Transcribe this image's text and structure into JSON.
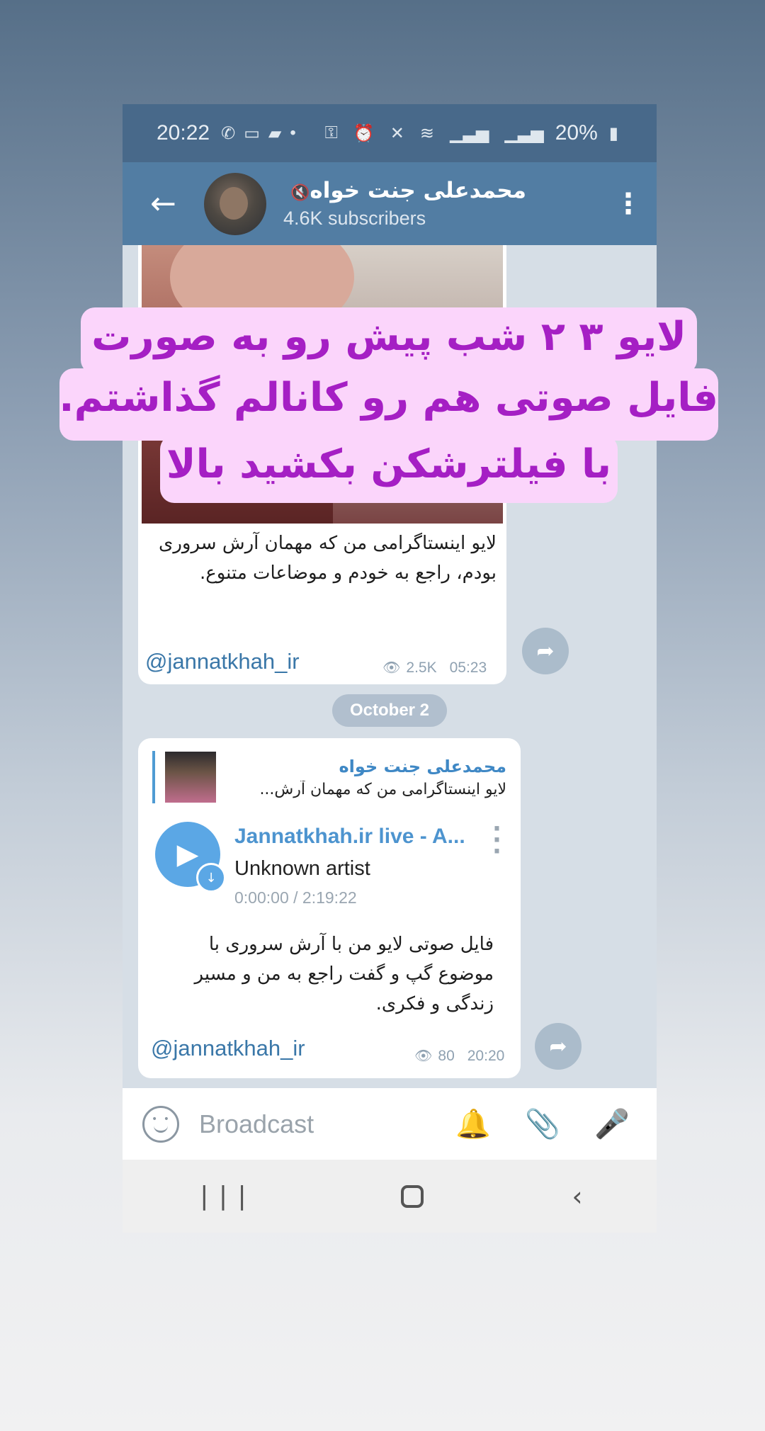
{
  "status_bar": {
    "time": "20:22",
    "left_icons": [
      "whatsapp-icon",
      "laptop-icon",
      "chat-icon",
      "dot-icon"
    ],
    "right_icons": [
      "key-icon",
      "alarm-icon",
      "mute-icon",
      "wifi-icon",
      "signal-icon",
      "signal-icon"
    ],
    "battery": "20%"
  },
  "header": {
    "channel_name": "محمدعلی جنت خواه",
    "muted": true,
    "subscribers": "4.6K subscribers"
  },
  "messages": [
    {
      "caption": "لایو اینستاگرامی من که مهمان آرش سروری بودم، راجع به خودم و موضاعات متنوع.",
      "signature": "@jannatkhah_ir",
      "views": "2.5K",
      "time": "05:23"
    },
    {
      "date_divider": "October 2",
      "reply": {
        "name": "محمدعلی جنت خواه",
        "snippet": "لایو اینستاگرامی من که مهمان آرش..."
      },
      "audio": {
        "title": "Jannatkhah.ir live - A...",
        "artist": "Unknown artist",
        "duration": "0:00:00 / 2:19:22"
      },
      "caption": "فایل صوتی لایو من با آرش سروری با موضوع گپ و گفت راجع به من و مسیر زندگی و فکری.",
      "signature": "@jannatkhah_ir",
      "views": "80",
      "time": "20:20"
    }
  ],
  "input": {
    "placeholder": "Broadcast"
  },
  "overlay_text": [
    "لایو ۳ ۲ شب پیش رو به صورت",
    "فایل صوتی هم رو کانالم گذاشتم.",
    "با فیلترشکن بکشید بالا"
  ],
  "colors": {
    "overlay_bg": "#fbd5fb",
    "overlay_text": "#a51fc4",
    "header_bg": "#527da3",
    "link": "#3a77a8",
    "audio_accent": "#5ba7e5"
  }
}
